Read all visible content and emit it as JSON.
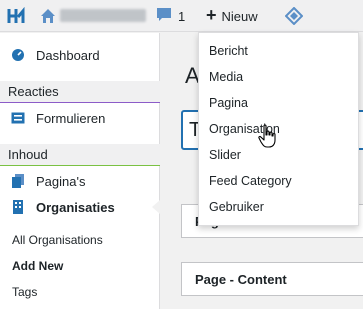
{
  "adminbar": {
    "comments_count": "1",
    "new_label": "Nieuw"
  },
  "new_menu": {
    "items": [
      "Bericht",
      "Media",
      "Pagina",
      "Organisation",
      "Slider",
      "Feed Category",
      "Gebruiker"
    ]
  },
  "sidebar": {
    "dashboard": "Dashboard",
    "section_reacties": "Reacties",
    "formulieren": "Formulieren",
    "section_inhoud": "Inhoud",
    "paginas": "Pagina's",
    "organisaties": "Organisaties",
    "submenu": [
      "All Organisations",
      "Add New",
      "Tags"
    ]
  },
  "main": {
    "title_partial": "A",
    "input_partial": "T",
    "banner_panel": "Page - Banner",
    "content_panel": "Page - Content"
  },
  "colors": {
    "accent_blue": "#2271b1",
    "purple_rule": "#8c5cc8",
    "green_rule": "#7ac142"
  }
}
